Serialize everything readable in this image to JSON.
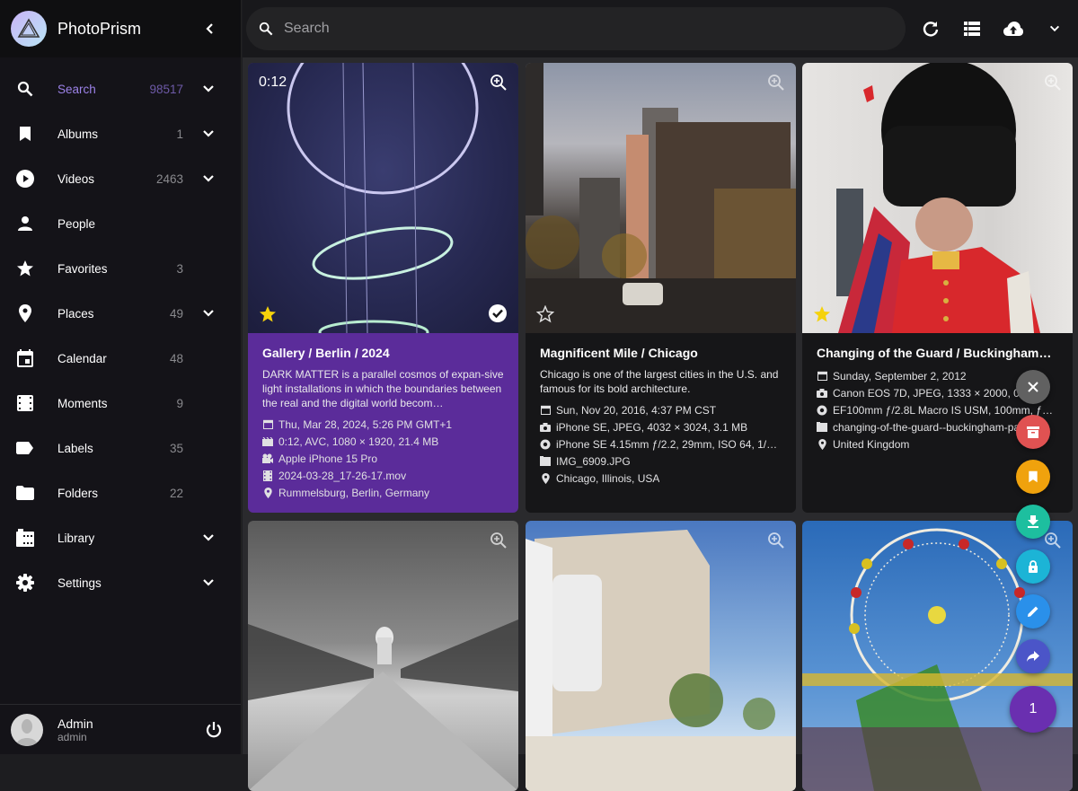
{
  "app": {
    "name": "PhotoPrism"
  },
  "sidebar": {
    "items": [
      {
        "label": "Search",
        "count": "98517",
        "expand": true,
        "active": true
      },
      {
        "label": "Albums",
        "count": "1",
        "expand": true
      },
      {
        "label": "Videos",
        "count": "2463",
        "expand": true
      },
      {
        "label": "People",
        "count": ""
      },
      {
        "label": "Favorites",
        "count": "3"
      },
      {
        "label": "Places",
        "count": "49",
        "expand": true
      },
      {
        "label": "Calendar",
        "count": "48"
      },
      {
        "label": "Moments",
        "count": "9"
      },
      {
        "label": "Labels",
        "count": "35"
      },
      {
        "label": "Folders",
        "count": "22"
      },
      {
        "label": "Library",
        "count": "",
        "expand": true
      },
      {
        "label": "Settings",
        "count": "",
        "expand": true
      }
    ],
    "user": {
      "name": "Admin",
      "login": "admin"
    }
  },
  "topbar": {
    "search_placeholder": "Search",
    "search_value": ""
  },
  "cards": [
    {
      "title": "Gallery / Berlin / 2024",
      "description": "DARK MATTER is a parallel cosmos of expan-sive light installations in which the boundaries between the real and the digital world becom…",
      "duration": "0:12",
      "favorite": true,
      "selected": true,
      "meta": [
        {
          "icon": "calendar-icon",
          "text": "Thu, Mar 28, 2024, 5:26 PM GMT+1"
        },
        {
          "icon": "movie-icon",
          "text": "0:12, AVC, 1080 × 1920, 21.4 MB"
        },
        {
          "icon": "video-camera-icon",
          "text": "Apple iPhone 15 Pro"
        },
        {
          "icon": "film-icon",
          "text": "2024-03-28_17-26-17.mov"
        },
        {
          "icon": "location-icon",
          "text": "Rummelsburg, Berlin, Germany"
        }
      ]
    },
    {
      "title": "Magnificent Mile / Chicago",
      "description": "Chicago is one of the largest cities in the U.S. and famous for its bold architecture.",
      "favorite": false,
      "meta": [
        {
          "icon": "calendar-icon",
          "text": "Sun, Nov 20, 2016, 4:37 PM CST"
        },
        {
          "icon": "camera-icon",
          "text": "iPhone SE, JPEG, 4032 × 3024, 3.1 MB"
        },
        {
          "icon": "aperture-icon",
          "text": "iPhone SE 4.15mm ƒ/2.2, 29mm, ISO 64, 1/…"
        },
        {
          "icon": "file-icon",
          "text": "IMG_6909.JPG"
        },
        {
          "icon": "location-icon",
          "text": "Chicago, Illinois, USA"
        }
      ]
    },
    {
      "title": "Changing of the Guard / Buckingham…",
      "description": "",
      "favorite": true,
      "meta": [
        {
          "icon": "calendar-icon",
          "text": "Sunday, September 2, 2012"
        },
        {
          "icon": "camera-icon",
          "text": "Canon EOS 7D, JPEG, 1333 × 2000, 0.8 MB"
        },
        {
          "icon": "aperture-icon",
          "text": "EF100mm ƒ/2.8L Macro IS USM, 100mm, ƒ…"
        },
        {
          "icon": "file-icon",
          "text": "changing-of-the-guard--buckingham-palace…"
        },
        {
          "icon": "location-icon",
          "text": "United Kingdom"
        }
      ]
    }
  ],
  "fabs": {
    "selection_count": "1",
    "colors": {
      "close": "#616161",
      "archive": "#e05252",
      "album": "#f0a20d",
      "download": "#1dbf9f",
      "private": "#1cb4d6",
      "edit": "#2a90ea",
      "share": "#4b55c8",
      "count": "#6a2fb0"
    }
  },
  "colors": {
    "accent": "#9c82e8",
    "selected_card": "#5b2c9a",
    "favorite": "#f5d20b"
  }
}
